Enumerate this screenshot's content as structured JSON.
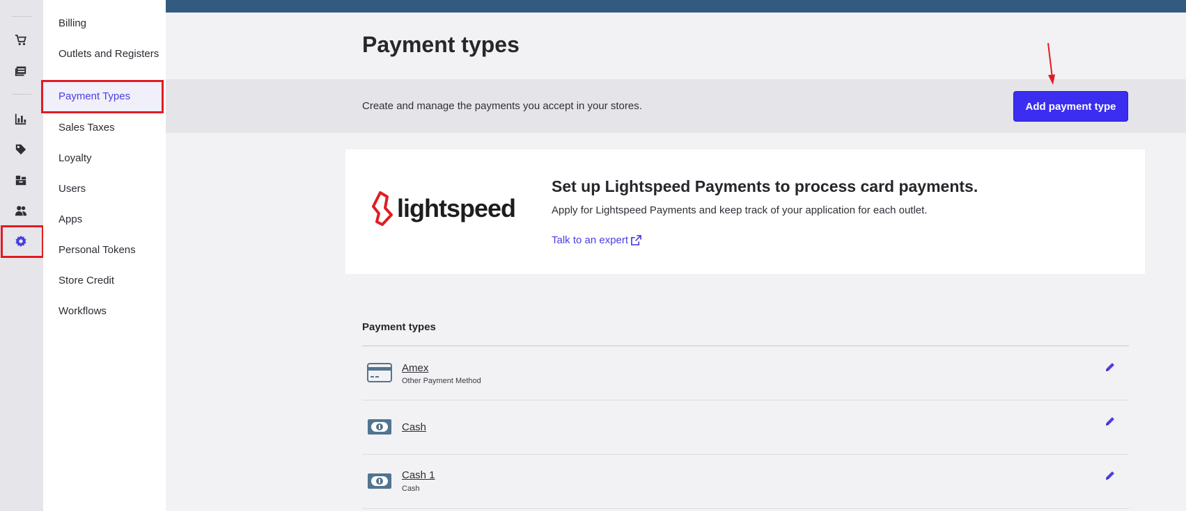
{
  "sidebar_rail": {
    "icons": [
      "cart-icon",
      "register-icon",
      "reports-icon",
      "tag-icon",
      "inventory-icon",
      "customers-icon",
      "gear-icon"
    ],
    "accent": "#4a3ee0"
  },
  "settings_nav": {
    "items": [
      {
        "label": "Billing"
      },
      {
        "label": "Outlets and Registers"
      },
      {
        "label": "Payment Types"
      },
      {
        "label": "Sales Taxes"
      },
      {
        "label": "Loyalty"
      },
      {
        "label": "Users"
      },
      {
        "label": "Apps"
      },
      {
        "label": "Personal Tokens"
      },
      {
        "label": "Store Credit"
      },
      {
        "label": "Workflows"
      }
    ],
    "active_index": 2
  },
  "header": {
    "title": "Payment types",
    "description": "Create and manage the payments you accept in your stores.",
    "add_button_label": "Add payment type"
  },
  "promo": {
    "logo_text": "lightspeed",
    "title": "Set up Lightspeed Payments to process card payments.",
    "description": "Apply for Lightspeed Payments and keep track of your application for each outlet.",
    "link_label": "Talk to an expert"
  },
  "payment_list": {
    "heading": "Payment types",
    "rows": [
      {
        "name": "Amex",
        "subtitle": "Other Payment Method",
        "icon": "credit-card-icon"
      },
      {
        "name": "Cash",
        "subtitle": "",
        "icon": "cash-icon"
      },
      {
        "name": "Cash 1",
        "subtitle": "Cash",
        "icon": "cash-icon"
      }
    ]
  },
  "colors": {
    "topbar": "#335a80",
    "primary_button": "#3b2ef0",
    "highlight_frame": "#e11b22",
    "brand_red": "#e11b22"
  }
}
